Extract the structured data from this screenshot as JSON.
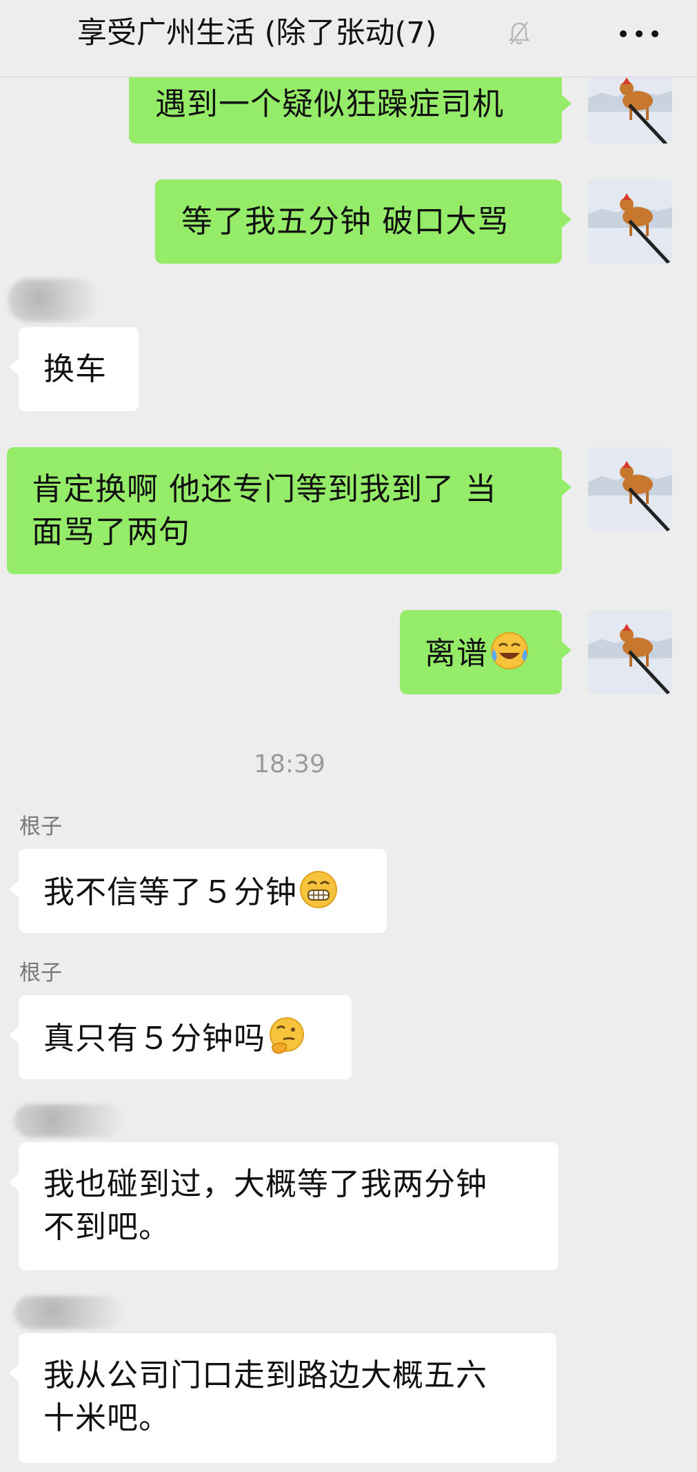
{
  "header": {
    "title": "享受广州生活 (除了张动(7)",
    "mute_icon": "bell-slash-icon",
    "more_icon": "more-dots-icon"
  },
  "messages": [
    {
      "text": "遇到一个疑似狂躁症司机"
    },
    {
      "text": "等了我五分钟 破口大骂"
    },
    {
      "text": "换车"
    },
    {
      "text": "肯定换啊 他还专门等到我到了 当\n面骂了两句"
    },
    {
      "text": "离谱",
      "emoji": "crying-laughing-emoji"
    },
    {
      "timestamp": "18:39"
    },
    {
      "sender": "根子",
      "text": "我不信等了５分钟",
      "emoji": "grinning-emoji"
    },
    {
      "sender": "根子",
      "text": "真只有５分钟吗",
      "emoji": "thinking-emoji"
    },
    {
      "text": "我也碰到过，大概等了我两分钟\n不到吧。"
    },
    {
      "text": "我从公司门口走到路边大概五六\n十米吧。"
    }
  ],
  "colors": {
    "background": "#ededed",
    "outgoing_bubble": "#95ec69",
    "incoming_bubble": "#ffffff",
    "timestamp_text": "#9a9a9a"
  }
}
